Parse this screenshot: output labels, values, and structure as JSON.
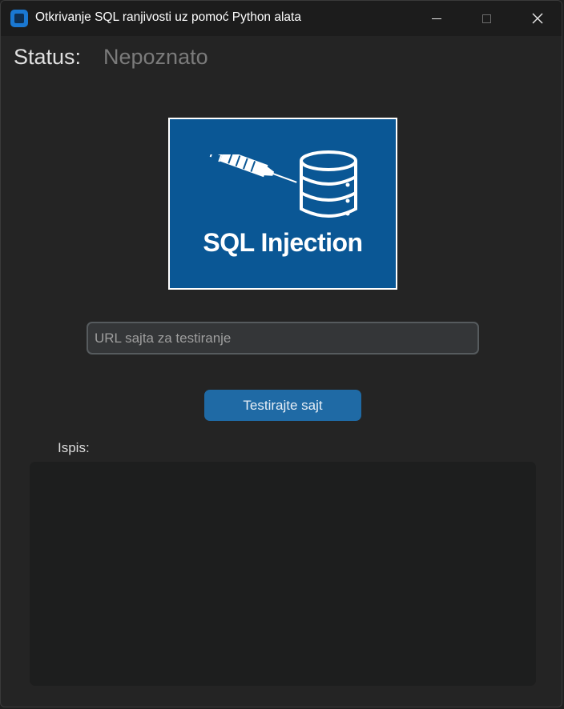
{
  "window": {
    "title": "Otkrivanje SQL ranjivosti uz pomoć Python alata",
    "icon": "app-icon",
    "controls": [
      "minimize-icon",
      "maximize-icon",
      "close-icon"
    ]
  },
  "status": {
    "label": "Status:",
    "value": "Nepoznato"
  },
  "banner": {
    "text": "SQL Injection",
    "icons": [
      "syringe-icon",
      "database-icon"
    ],
    "background_color": "#0a5795"
  },
  "url_input": {
    "placeholder": "URL sajta za testiranje",
    "value": ""
  },
  "test_button": {
    "label": "Testirajte sajt",
    "color": "#1f6aa5"
  },
  "output": {
    "label": "Ispis:",
    "content": ""
  }
}
